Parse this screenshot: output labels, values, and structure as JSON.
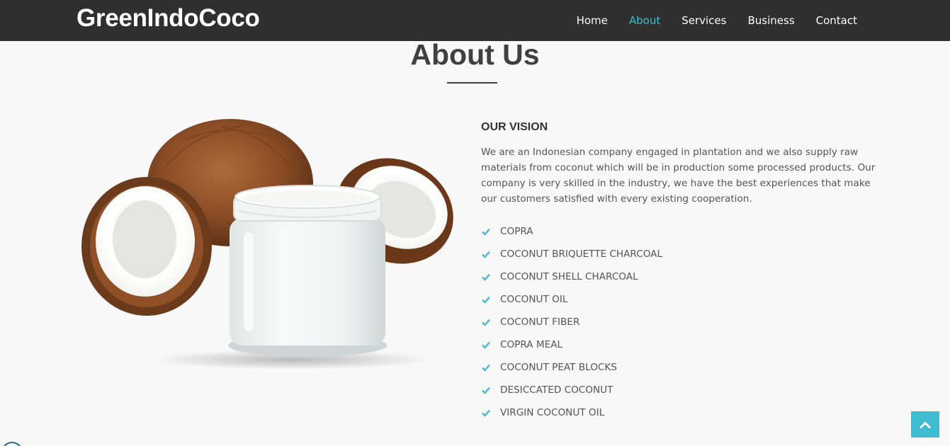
{
  "header": {
    "brand": "GreenIndoCoco",
    "nav": [
      {
        "label": "Home",
        "active": false
      },
      {
        "label": "About",
        "active": true
      },
      {
        "label": "Services",
        "active": false
      },
      {
        "label": "Business",
        "active": false
      },
      {
        "label": "Contact",
        "active": false
      }
    ]
  },
  "about": {
    "title": "About Us",
    "vision_title": "OUR VISION",
    "vision_text": "We are an Indonesian company engaged in plantation and we also supply raw materials from coconut which will be in production some processed products. Our company is very skilled in the industry, we have the best experiences that make our customers satisfied with every existing cooperation.",
    "products": [
      "COPRA",
      "COCONUT BRIQUETTE CHARCOAL",
      "COCONUT SHELL CHARCOAL",
      "COCONUT OIL",
      "COCONUT FIBER",
      "COPRA MEAL",
      "COCONUT PEAT BLOCKS",
      "DESICCATED COCONUT",
      "VIRGIN COCONUT OIL"
    ]
  },
  "icons": {
    "check": "check-icon",
    "back_to_top": "chevron-up-icon"
  },
  "colors": {
    "accent": "#3fbcd0",
    "navbar": "#2f2f2f",
    "background": "#f8f8f8"
  }
}
